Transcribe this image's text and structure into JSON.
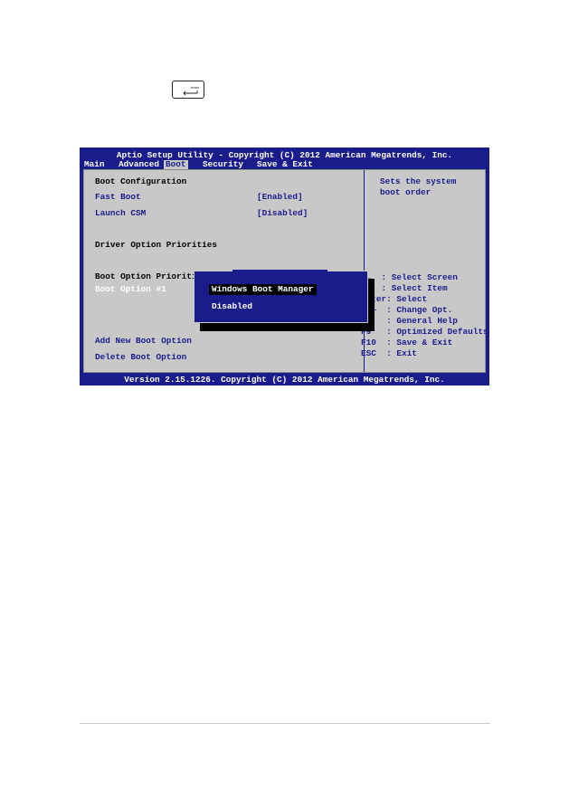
{
  "bios": {
    "title": "Aptio Setup Utility - Copyright (C) 2012 American Megatrends, Inc.",
    "menu": [
      {
        "label": "Main"
      },
      {
        "label": "Advanced"
      },
      {
        "label": "Boot",
        "active": true
      },
      {
        "label": "Security"
      },
      {
        "label": "Save & Exit"
      }
    ],
    "left": {
      "boot_configuration": "Boot Configuration",
      "fast_boot_label": "Fast Boot",
      "fast_boot_value": "[Enabled]",
      "launch_csm_label": "Launch CSM",
      "launch_csm_value": "[Disabled]",
      "driver_option_priorities": "Driver Option Priorities",
      "boot_option_priorities": "Boot Option Prioriti",
      "boot_option_1": "Boot Option #1",
      "add_new_boot_option": "Add New Boot Option",
      "delete_boot_option": "Delete Boot Option"
    },
    "help": {
      "line1": "Sets the system",
      "line2": "boot order"
    },
    "keys": [
      "→←  : Select Screen",
      "↑↓  : Select Item",
      "Enter: Select",
      "+/—  : Change Opt.",
      "F1   : General Help",
      "F9   : Optimized Defaults",
      "F10  : Save & Exit",
      "ESC  : Exit"
    ],
    "popup": {
      "selected": "Windows Boot Manager",
      "option": "Disabled"
    },
    "footer": "Version 2.15.1226. Copyright (C) 2012 American Megatrends, Inc."
  },
  "icons": {
    "enter_key": "enter-key-icon"
  },
  "colors": {
    "bios_blue": "#1a1c8c",
    "bios_gray": "#c8c8c8"
  }
}
